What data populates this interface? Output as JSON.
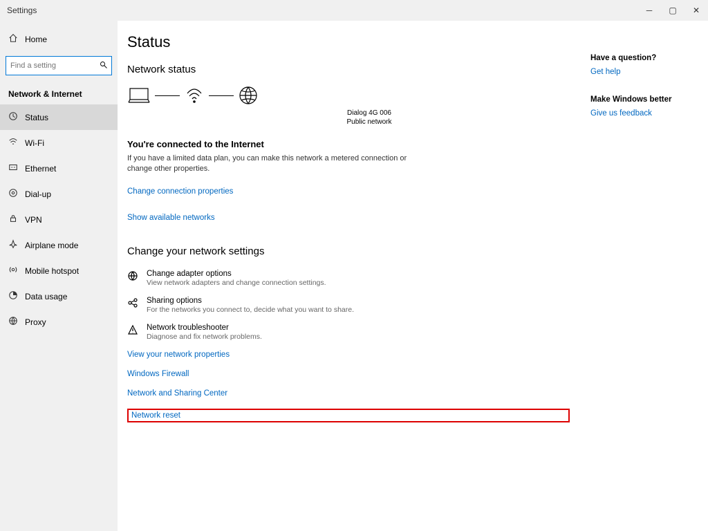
{
  "window": {
    "title": "Settings"
  },
  "sidebar": {
    "home": "Home",
    "search_placeholder": "Find a setting",
    "section": "Network & Internet",
    "items": [
      {
        "label": "Status",
        "icon": "status"
      },
      {
        "label": "Wi-Fi",
        "icon": "wifi"
      },
      {
        "label": "Ethernet",
        "icon": "ethernet"
      },
      {
        "label": "Dial-up",
        "icon": "dialup"
      },
      {
        "label": "VPN",
        "icon": "vpn"
      },
      {
        "label": "Airplane mode",
        "icon": "airplane"
      },
      {
        "label": "Mobile hotspot",
        "icon": "hotspot"
      },
      {
        "label": "Data usage",
        "icon": "datausage"
      },
      {
        "label": "Proxy",
        "icon": "proxy"
      }
    ]
  },
  "page": {
    "title": "Status",
    "network_status": "Network status",
    "net_name": "Dialog 4G 006",
    "net_type": "Public network",
    "connected_h": "You're connected to the Internet",
    "connected_p": "If you have a limited data plan, you can make this network a metered connection or change other properties.",
    "change_conn": "Change connection properties",
    "show_avail": "Show available networks",
    "change_head": "Change your network settings",
    "options": [
      {
        "title": "Change adapter options",
        "desc": "View network adapters and change connection settings.",
        "icon": "globe"
      },
      {
        "title": "Sharing options",
        "desc": "For the networks you connect to, decide what you want to share.",
        "icon": "share"
      },
      {
        "title": "Network troubleshooter",
        "desc": "Diagnose and fix network problems.",
        "icon": "warn"
      }
    ],
    "links": {
      "view_props": "View your network properties",
      "firewall": "Windows Firewall",
      "sharing_center": "Network and Sharing Center",
      "reset": "Network reset"
    }
  },
  "right": {
    "q_head": "Have a question?",
    "help": "Get help",
    "better_head": "Make Windows better",
    "feedback": "Give us feedback"
  }
}
